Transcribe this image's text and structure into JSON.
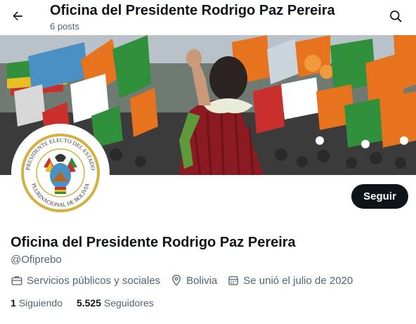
{
  "header": {
    "title": "Oficina del Presidente Rodrigo Paz Pereira",
    "posts_count": "6 posts",
    "back_icon": "arrow-left-icon",
    "search_icon": "search-icon"
  },
  "banner": {
    "description_icon": "rally-crowd-photo"
  },
  "avatar": {
    "seal_text_top": "PRESIDENTE ELECTO DEL ESTADO",
    "seal_text_bottom": "PLURINACIONAL DE BOLIVIA"
  },
  "profile": {
    "follow_label": "Seguir",
    "name": "Oficina del Presidente Rodrigo Paz Pereira",
    "handle": "@Ofiprebo",
    "category": "Servicios públicos y sociales",
    "location": "Bolivia",
    "joined": "Se unió el julio de 2020",
    "following_count": "1",
    "following_label": "Siguiendo",
    "followers_count": "5.525",
    "followers_label": "Seguidores"
  },
  "colors": {
    "text": "#0f1419",
    "muted": "#536471",
    "button_bg": "#0f1419",
    "banner_orange": "#e8731f",
    "sweater": "#8b1a22"
  }
}
